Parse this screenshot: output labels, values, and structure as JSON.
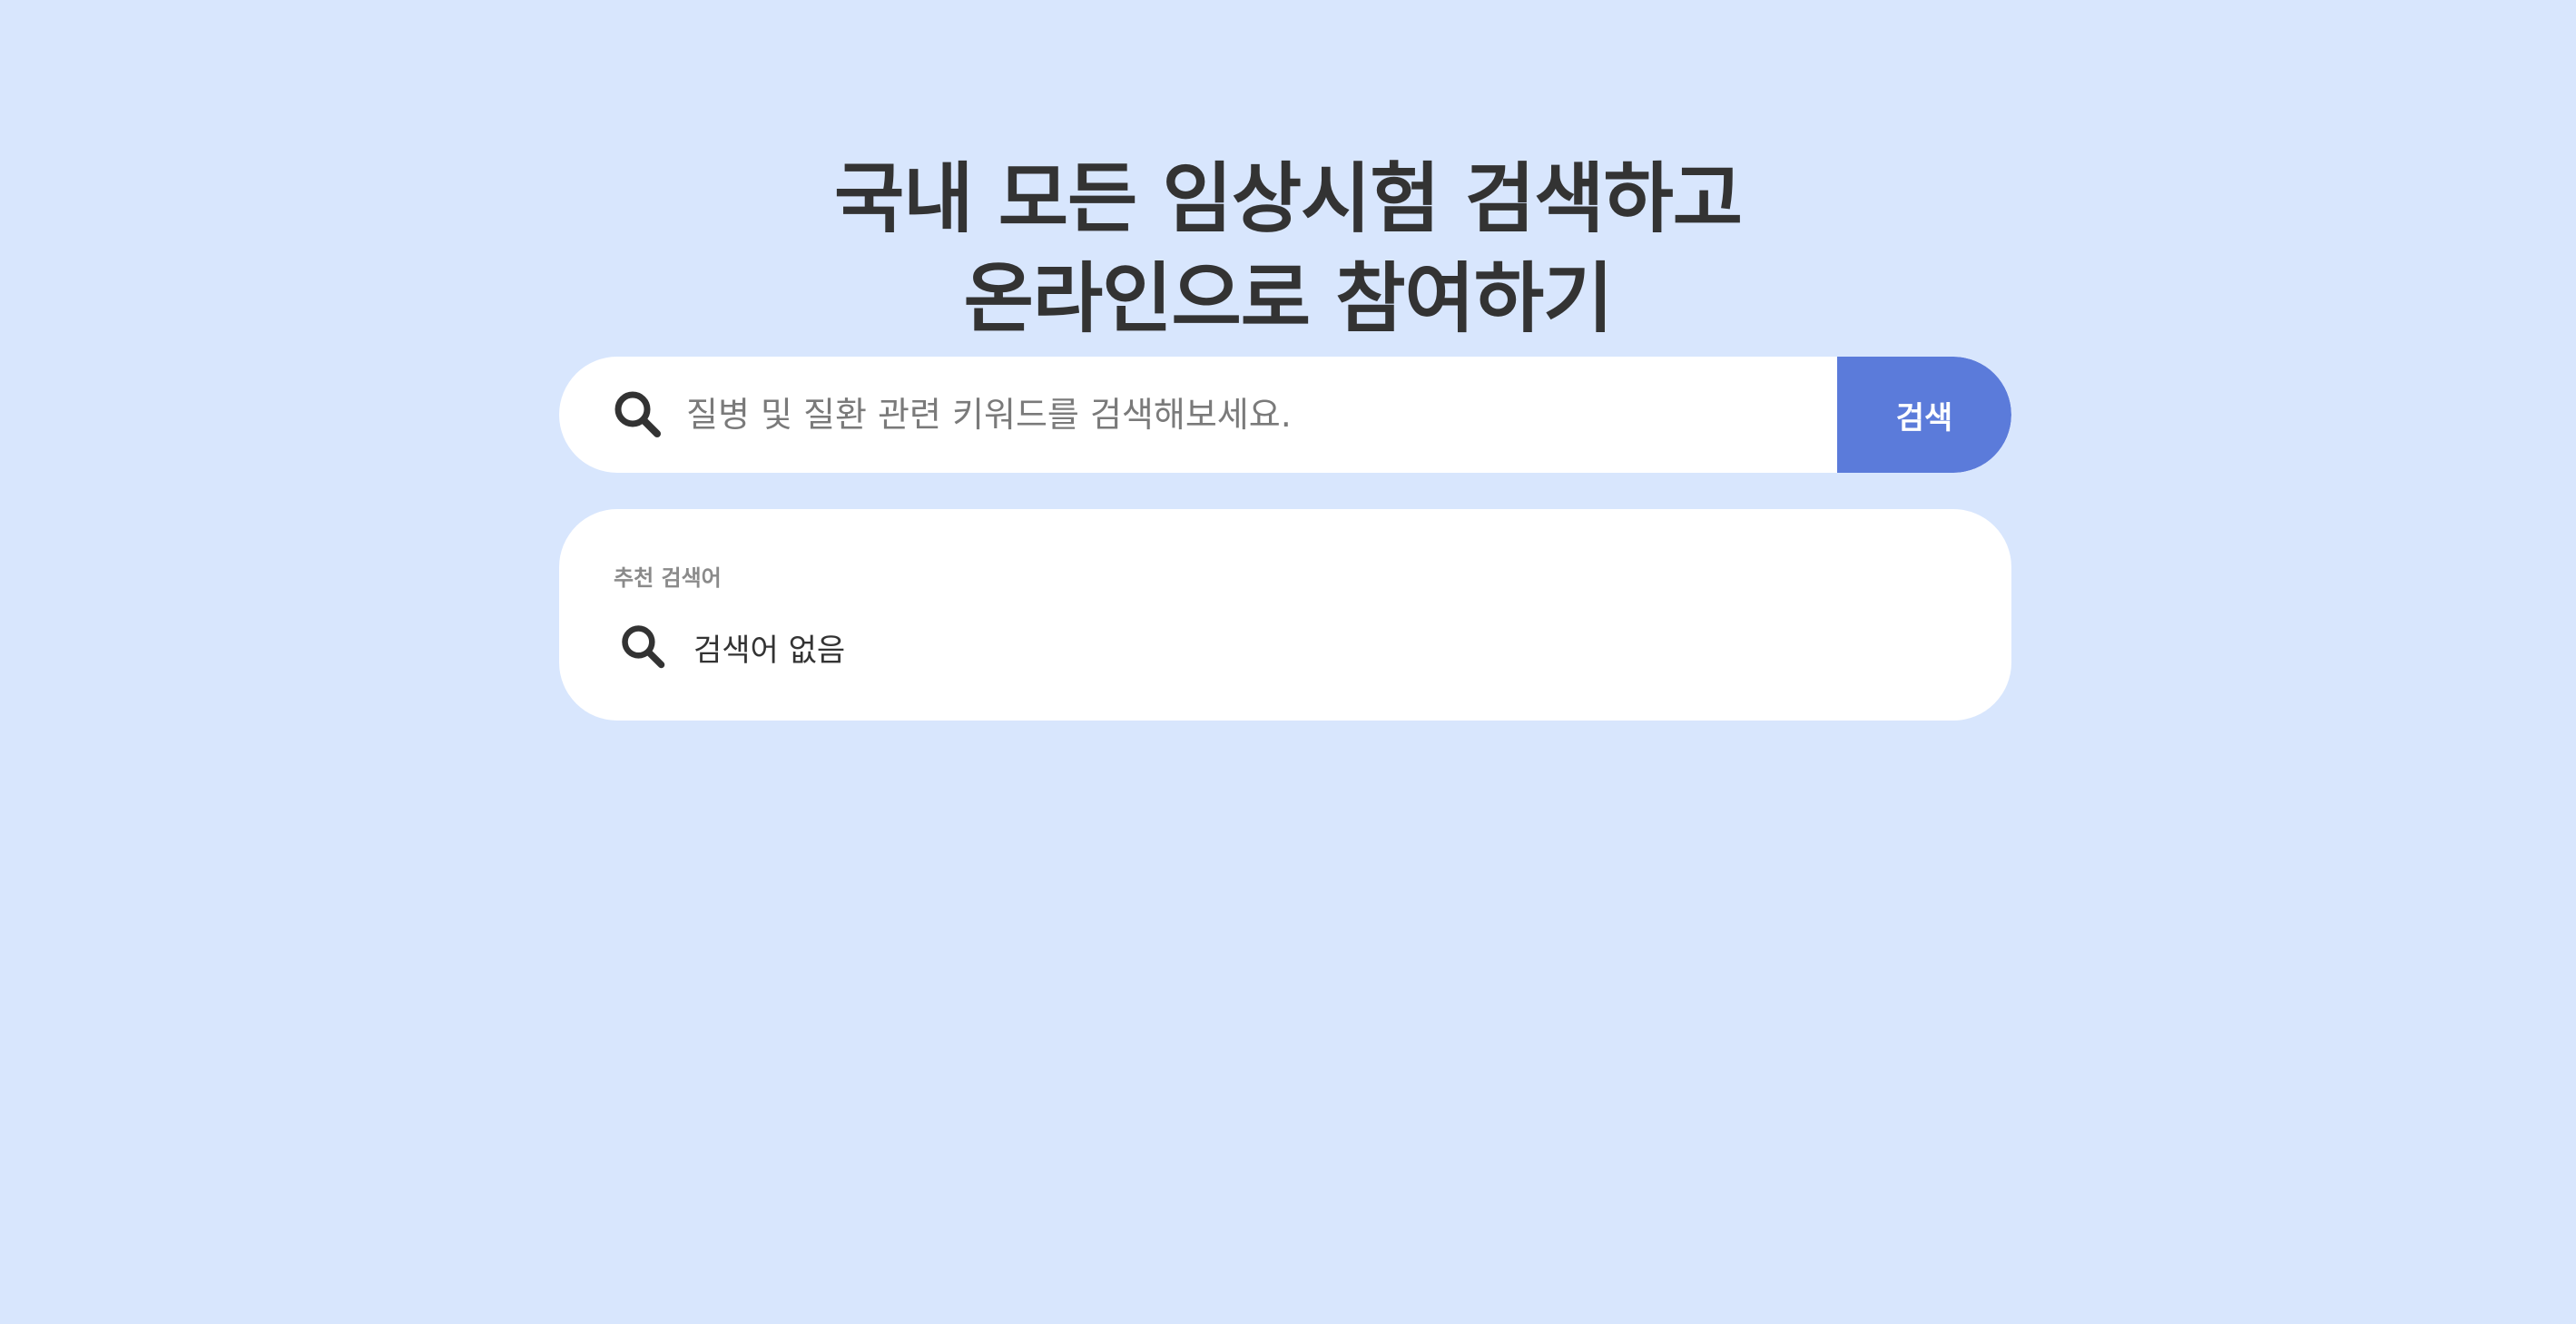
{
  "hero": {
    "line1": "국내 모든 임상시험 검색하고",
    "line2": "온라인으로 참여하기"
  },
  "search": {
    "placeholder": "질병 및 질환 관련 키워드를 검색해보세요.",
    "value": "",
    "button_label": "검색",
    "icon": "search-icon"
  },
  "suggestions": {
    "label": "추천 검색어",
    "items": [
      {
        "text": "검색어 없음",
        "icon": "search-icon"
      }
    ]
  },
  "colors": {
    "background": "#d8e6fd",
    "accent": "#5b7bda",
    "text": "#333333",
    "muted": "#8a8a8a"
  }
}
